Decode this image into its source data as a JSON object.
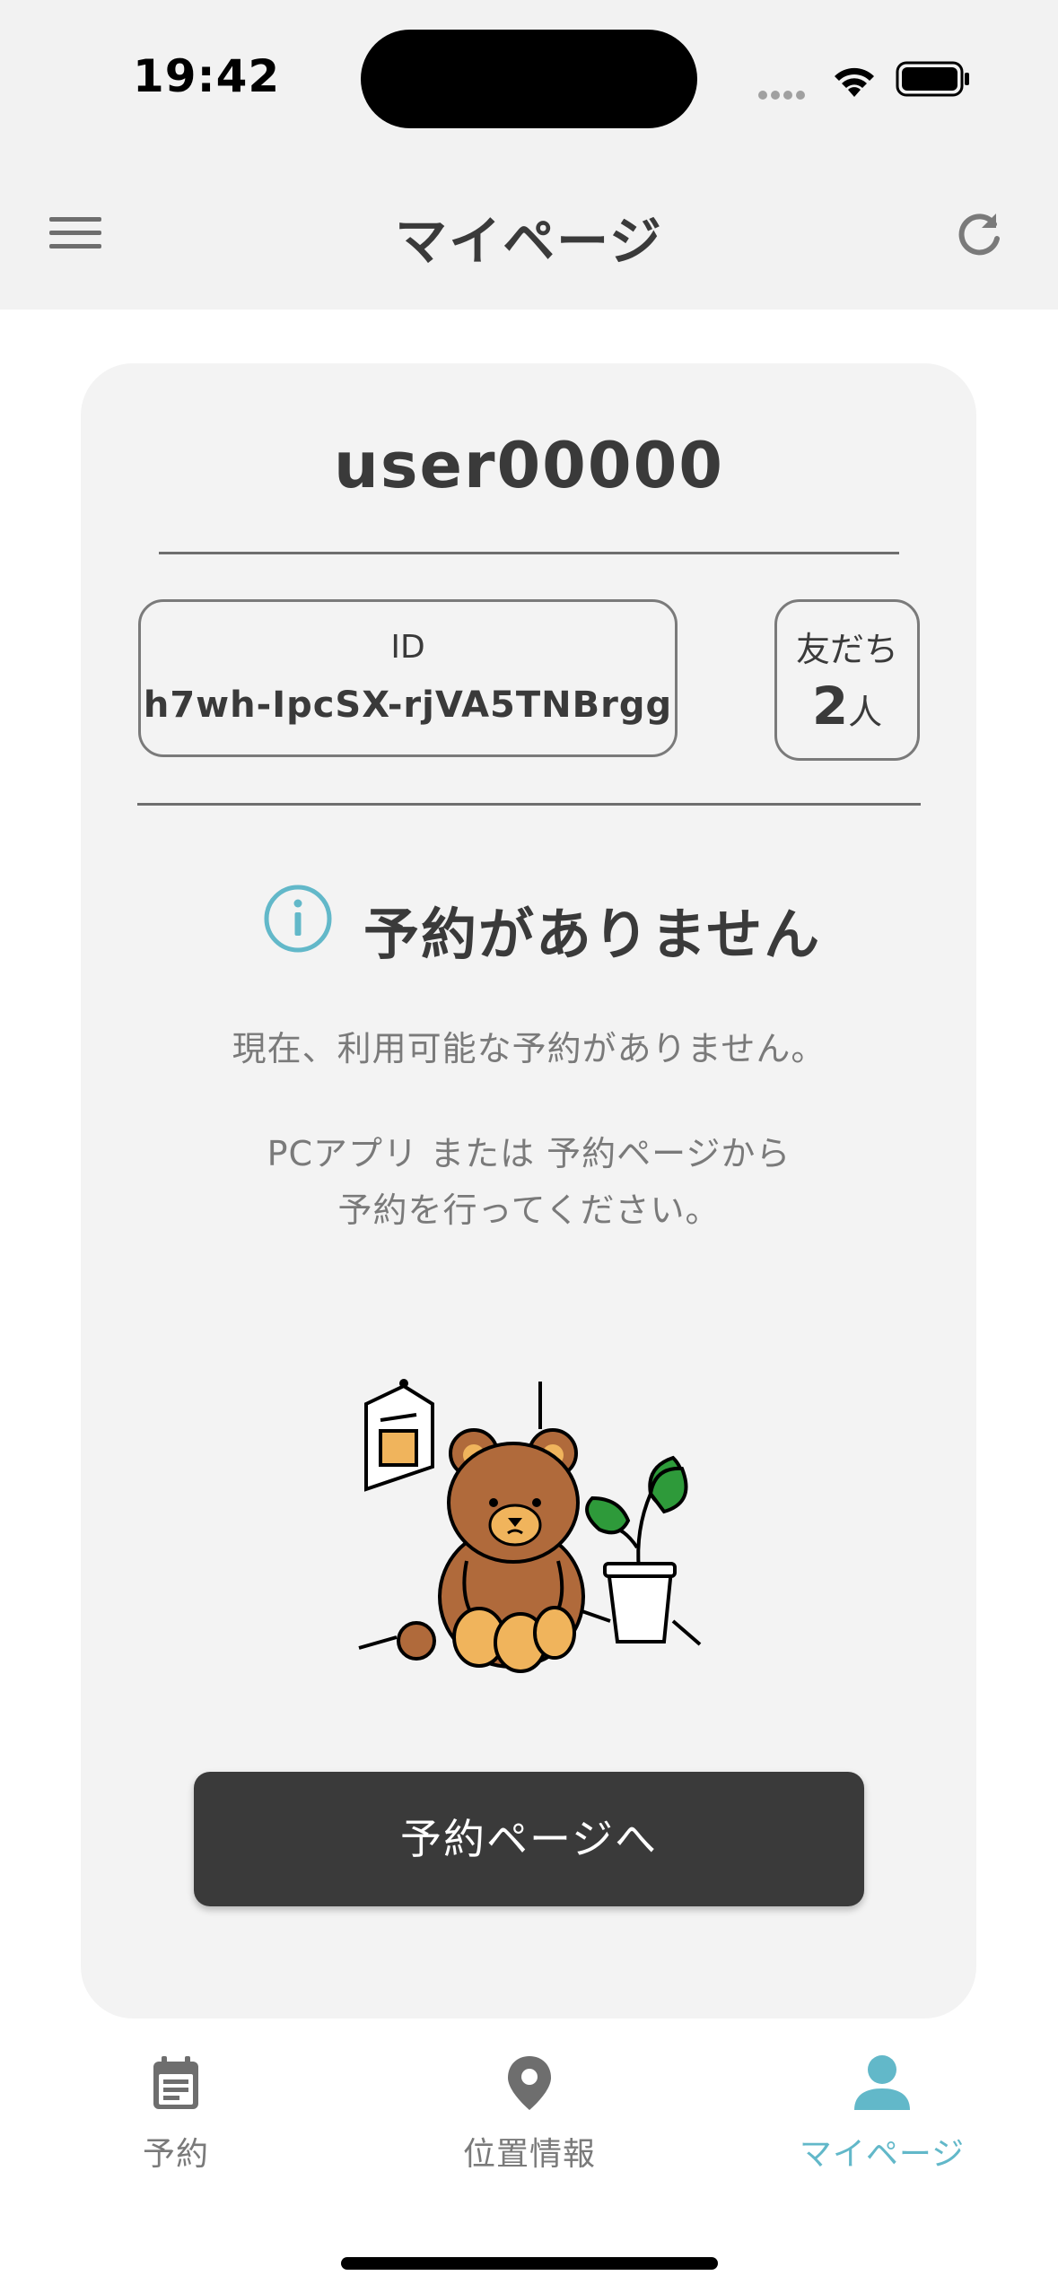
{
  "status_bar": {
    "time": "19:42"
  },
  "header": {
    "title": "マイページ",
    "menu_icon": "hamburger-icon",
    "refresh_icon": "refresh-icon"
  },
  "profile": {
    "username": "user00000",
    "id_label": "ID",
    "id_value": "h7wh-IpcSX-rjVA5TNBrgg",
    "friends_label": "友だち",
    "friends_count": "2",
    "friends_unit": "人"
  },
  "empty_state": {
    "icon": "info-icon",
    "title": "予約がありません",
    "message": "現在、利用可能な予約がありません。",
    "hint_line1": "PCアプリ または 予約ページから",
    "hint_line2": "予約を行ってください。"
  },
  "cta": {
    "label": "予約ページへ"
  },
  "tabs": [
    {
      "label": "予約",
      "icon": "calendar-icon",
      "active": false
    },
    {
      "label": "位置情報",
      "icon": "location-pin-icon",
      "active": false
    },
    {
      "label": "マイページ",
      "icon": "person-icon",
      "active": true
    }
  ],
  "colors": {
    "accent": "#62b8c9",
    "dark": "#3a3a3a",
    "card": "#f3f3f3",
    "header_bg": "#f2f2f2"
  }
}
